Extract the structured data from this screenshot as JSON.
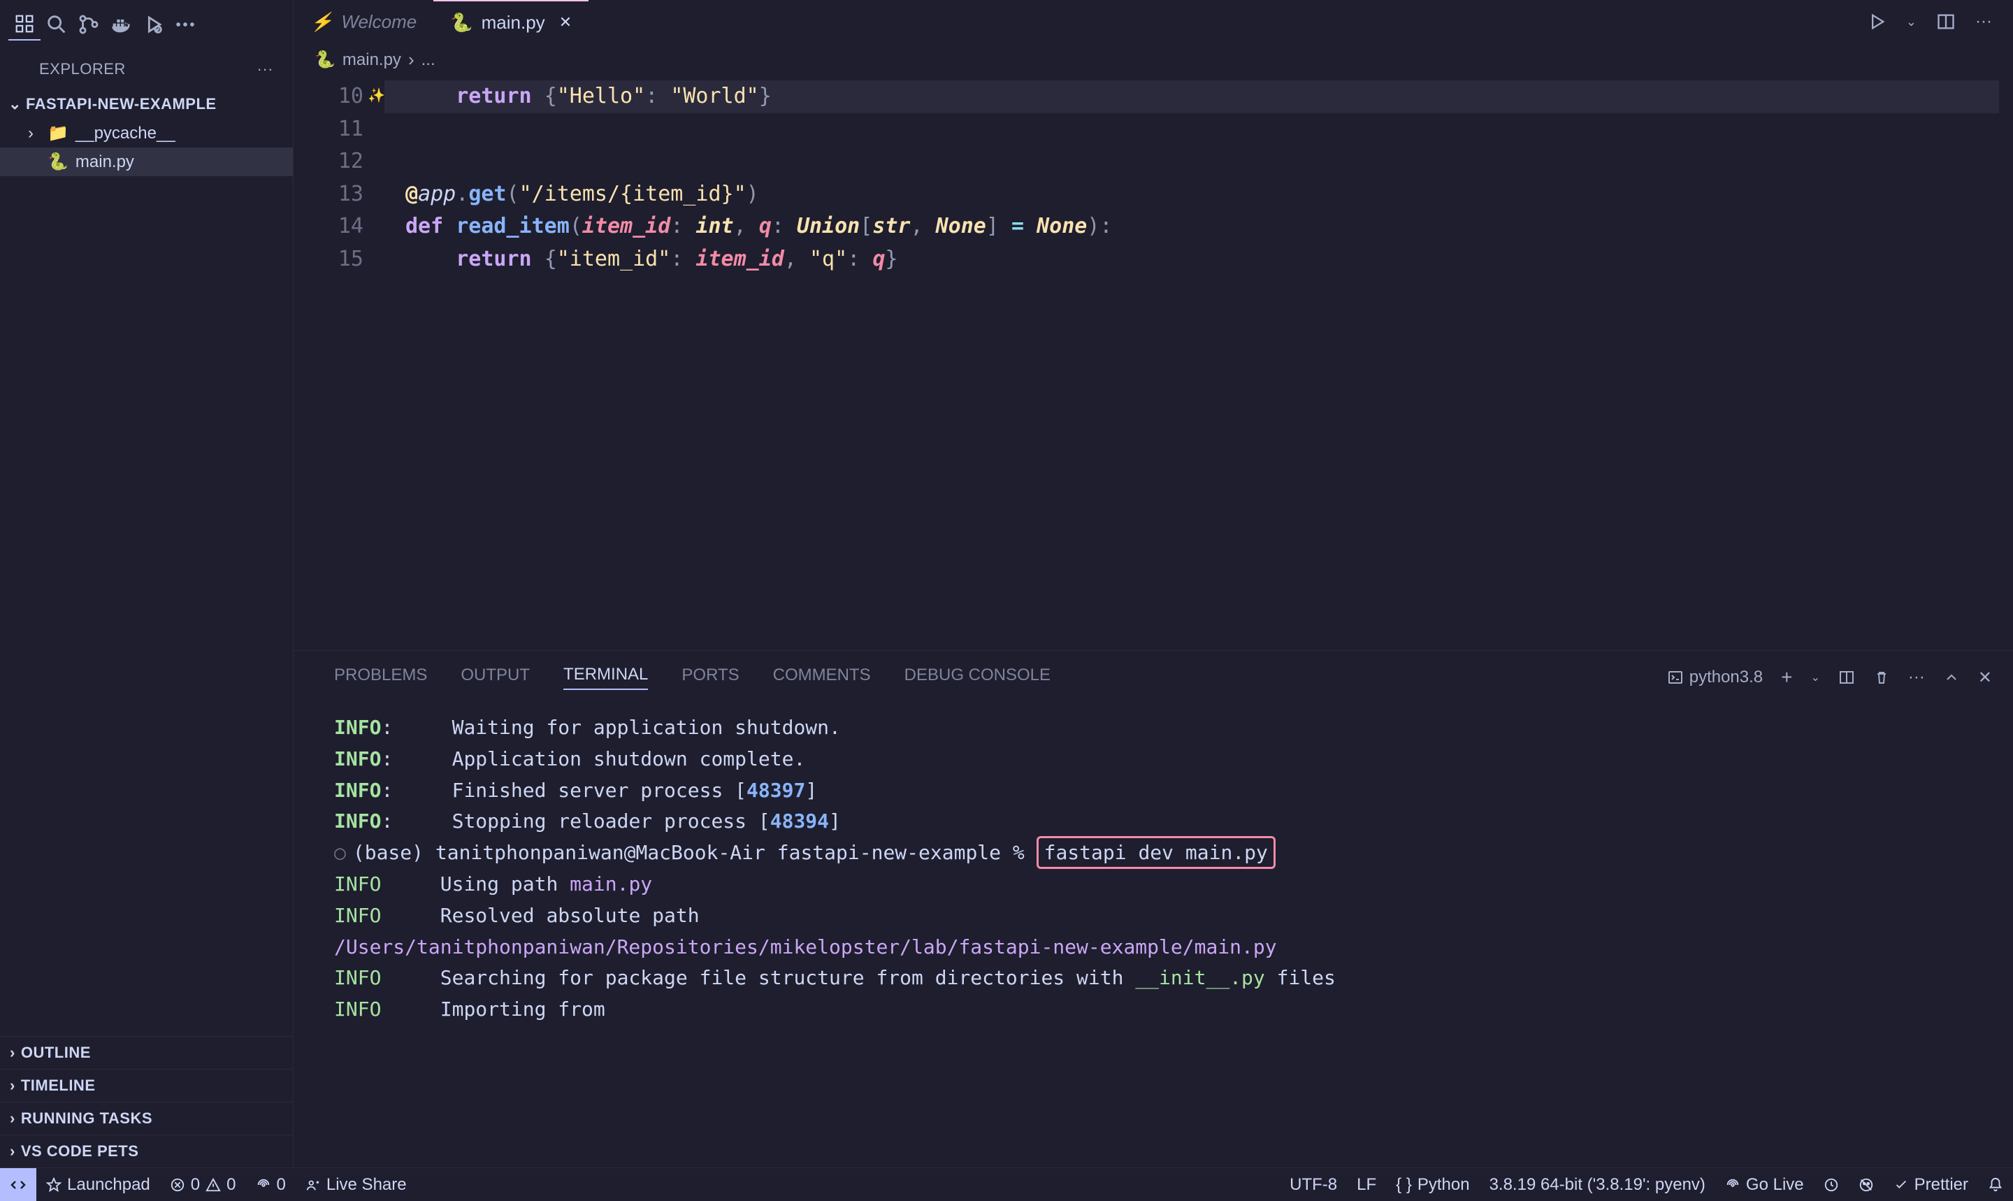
{
  "sidebar": {
    "title": "EXPLORER",
    "project": "FASTAPI-NEW-EXAMPLE",
    "tree": [
      {
        "name": "__pycache__",
        "type": "folder"
      },
      {
        "name": "main.py",
        "type": "file",
        "selected": true
      }
    ],
    "sections": [
      "OUTLINE",
      "TIMELINE",
      "RUNNING TASKS",
      "VS CODE PETS"
    ]
  },
  "tabs": {
    "welcome": "Welcome",
    "active": "main.py"
  },
  "breadcrumb": {
    "file": "main.py",
    "more": "..."
  },
  "code": {
    "lines": [
      10,
      11,
      12,
      13,
      14,
      15
    ],
    "l10_return": "return",
    "l10_hello": "\"Hello\"",
    "l10_world": "\"World\"",
    "l13_at": "@",
    "l13_app": "app",
    "l13_get": "get",
    "l13_route": "\"/items/{item_id}\"",
    "l14_def": "def",
    "l14_fn": "read_item",
    "l14_p1": "item_id",
    "l14_t1": "int",
    "l14_p2": "q",
    "l14_union": "Union",
    "l14_str": "str",
    "l14_none": "None",
    "l14_none2": "None",
    "l15_return": "return",
    "l15_k1": "\"item_id\"",
    "l15_v1": "item_id",
    "l15_k2": "\"q\"",
    "l15_v2": "q"
  },
  "panel": {
    "tabs": [
      "PROBLEMS",
      "OUTPUT",
      "TERMINAL",
      "PORTS",
      "COMMENTS",
      "DEBUG CONSOLE"
    ],
    "terminal_name": "python3.8"
  },
  "terminal": {
    "info": "INFO",
    "l1": "     Waiting for application shutdown.",
    "l2": "     Application shutdown complete.",
    "l3a": "     Finished server process [",
    "l3n": "48397",
    "l3b": "]",
    "l4a": "     Stopping reloader process [",
    "l4n": "48394",
    "l4b": "]",
    "prompt": "(base) tanitphonpaniwan@MacBook-Air fastapi-new-example % ",
    "cmd": "fastapi dev main.py",
    "l6a": "     Using path ",
    "l6p": "main.py",
    "l7": "     Resolved absolute path ",
    "l7p": "/Users/tanitphonpaniwan/Repositories/mikelopster/lab/fastapi-new-example/main.py",
    "l8a": "     Searching for package file structure from directories with ",
    "l8i": "__init__.py",
    "l8b": " files",
    "l9": "     Importing from"
  },
  "status": {
    "launchpad": "Launchpad",
    "errors": "0",
    "warnings": "0",
    "ports": "0",
    "liveshare": "Live Share",
    "encoding": "UTF-8",
    "eol": "LF",
    "lang": "Python",
    "interpreter": "3.8.19 64-bit ('3.8.19': pyenv)",
    "golive": "Go Live",
    "prettier": "Prettier"
  }
}
